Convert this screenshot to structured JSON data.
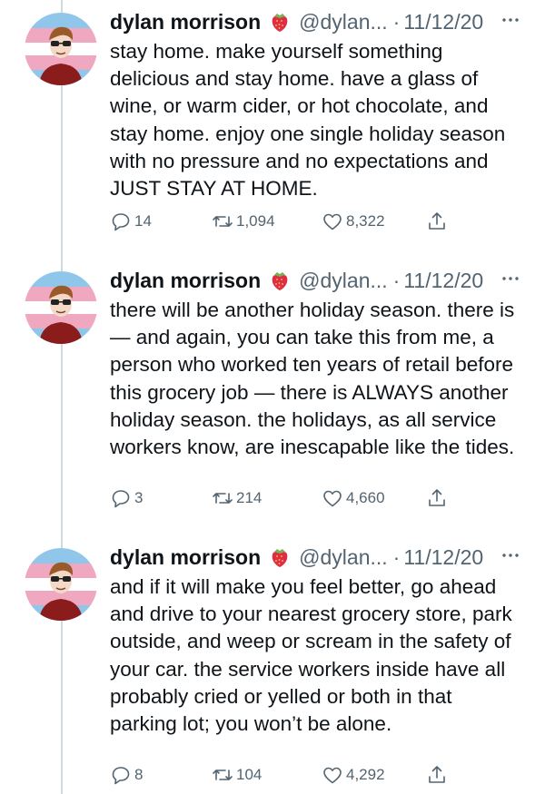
{
  "colors": {
    "text": "#0f1419",
    "muted": "#536471",
    "thread_line": "#cfd9de",
    "flag_blue": "#8fc6ea",
    "flag_pink": "#f0a8c0"
  },
  "tweets": [
    {
      "author_name": "dylan morrison",
      "emoji": "strawberry-icon",
      "handle": "@dylan...",
      "separator": "·",
      "date": "11/12/20",
      "text": "stay home. make yourself something delicious and stay home. have a glass of wine, or warm cider, or hot chocolate, and stay home. enjoy one single holiday season with no pressure and no expectations and JUST STAY AT HOME.",
      "replies": "14",
      "retweets": "1,094",
      "likes": "8,322"
    },
    {
      "author_name": "dylan morrison",
      "emoji": "strawberry-icon",
      "handle": "@dylan...",
      "separator": "·",
      "date": "11/12/20",
      "text": "there will be another holiday season. there is — and again, you can take this from me, a person who worked ten years of retail before this grocery job — there is ALWAYS another holiday season. the holidays, as all service workers know, are inescapable like the tides.",
      "replies": "3",
      "retweets": "214",
      "likes": "4,660"
    },
    {
      "author_name": "dylan morrison",
      "emoji": "strawberry-icon",
      "handle": "@dylan...",
      "separator": "·",
      "date": "11/12/20",
      "text": "and if it will make you feel better, go ahead and drive to your nearest grocery store, park outside, and weep or scream in the safety of your car. the service workers inside have all probably cried or yelled or both in that parking lot; you won’t be alone.",
      "replies": "8",
      "retweets": "104",
      "likes": "4,292"
    }
  ]
}
